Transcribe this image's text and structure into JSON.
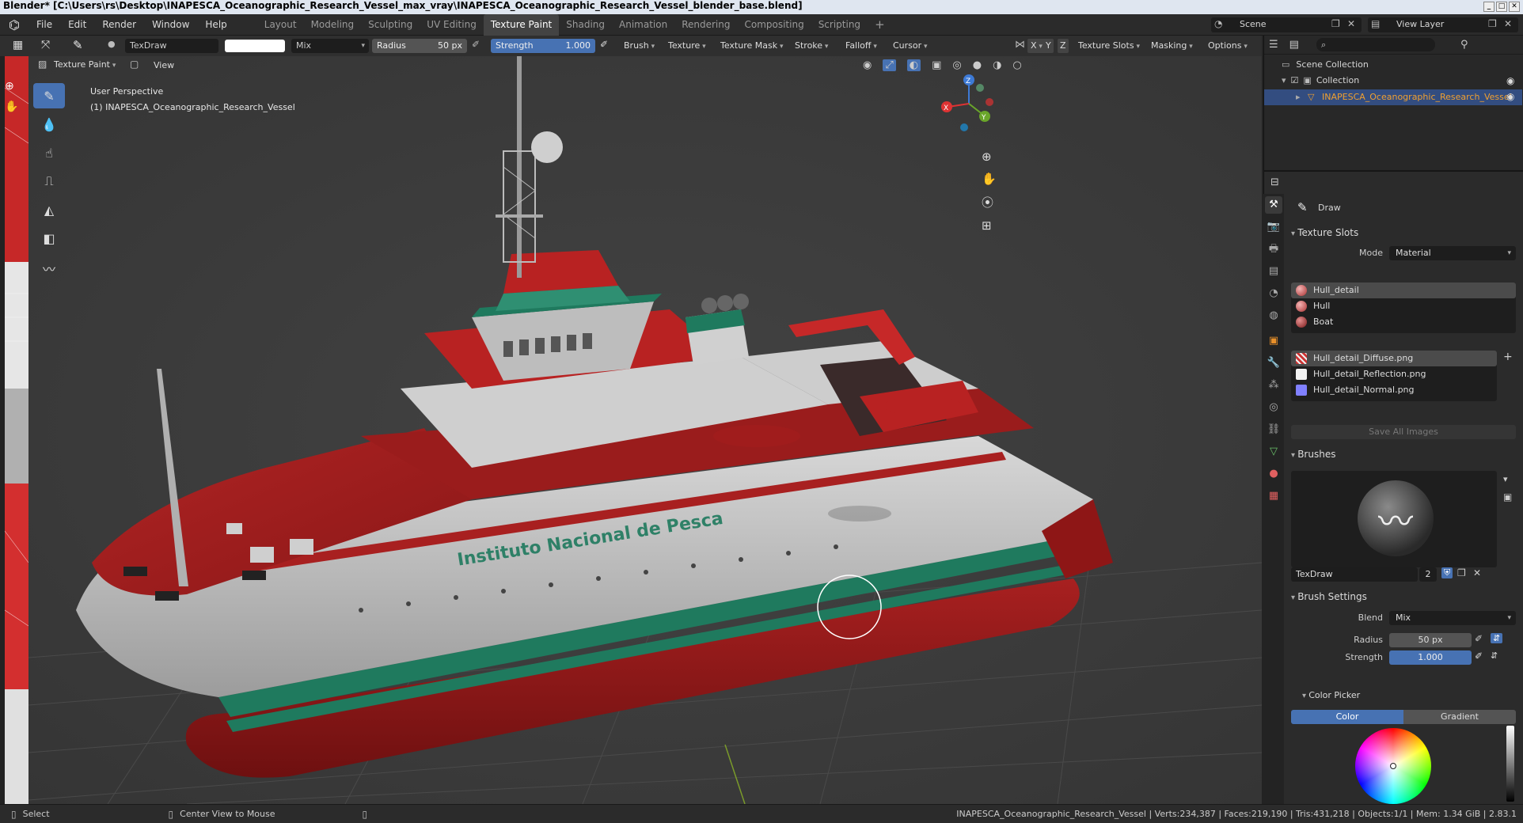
{
  "window": {
    "title": "Blender* [C:\\Users\\rs\\Desktop\\INAPESCA_Oceanographic_Research_Vessel_max_vray\\INAPESCA_Oceanographic_Research_Vessel_blender_base.blend]"
  },
  "menu": [
    "File",
    "Edit",
    "Render",
    "Window",
    "Help"
  ],
  "workspaces": [
    "Layout",
    "Modeling",
    "Sculpting",
    "UV Editing",
    "Texture Paint",
    "Shading",
    "Animation",
    "Rendering",
    "Compositing",
    "Scripting"
  ],
  "active_workspace": "Texture Paint",
  "scene": {
    "label": "Scene",
    "view_layer": "View Layer"
  },
  "header": {
    "brush_name": "TexDraw",
    "blend": "Mix",
    "radius_label": "Radius",
    "radius_value": "50 px",
    "strength_label": "Strength",
    "strength_value": "1.000",
    "dropdowns": [
      "Brush",
      "Texture",
      "Texture Mask",
      "Stroke",
      "Falloff",
      "Cursor"
    ],
    "axes": [
      "X",
      "Y",
      "Z"
    ],
    "right_dropdowns": [
      "Texture Slots",
      "Masking",
      "Options"
    ],
    "mode": "Texture Paint",
    "view": "View"
  },
  "viewport": {
    "perspective": "User Perspective",
    "object": "(1) INAPESCA_Oceanographic_Research_Vessel",
    "hull_text": "Instituto Nacional de Pesca",
    "gizmo": {
      "x": "X",
      "y": "Y",
      "z": "Z"
    }
  },
  "outliner": {
    "root": "Scene Collection",
    "collection": "Collection",
    "object": "INAPESCA_Oceanographic_Research_Vessel"
  },
  "properties": {
    "tool": "Draw",
    "texture_slots": {
      "title": "Texture Slots",
      "mode_label": "Mode",
      "mode_value": "Material",
      "materials": [
        "Hull_detail",
        "Hull",
        "Boat"
      ],
      "images": [
        "Hull_detail_Diffuse.png",
        "Hull_detail_Reflection.png",
        "Hull_detail_Normal.png"
      ],
      "save_all": "Save All Images"
    },
    "brushes": {
      "title": "Brushes",
      "name": "TexDraw",
      "users": "2"
    },
    "brush_settings": {
      "title": "Brush Settings",
      "blend_label": "Blend",
      "blend_value": "Mix",
      "radius_label": "Radius",
      "radius_value": "50 px",
      "strength_label": "Strength",
      "strength_value": "1.000"
    },
    "color_picker": {
      "title": "Color Picker",
      "tab_color": "Color",
      "tab_gradient": "Gradient"
    }
  },
  "status": {
    "select": "Select",
    "center": "Center View to Mouse",
    "stats": "INAPESCA_Oceanographic_Research_Vessel | Verts:234,387 | Faces:219,190 | Tris:431,218 | Objects:1/1 | Mem: 1.34 GiB | 2.83.1"
  },
  "colors": {
    "accent": "#4772b3",
    "hull_red": "#a01c1c",
    "hull_green": "#1f7a5e",
    "hull_white": "#c9c9c9"
  }
}
